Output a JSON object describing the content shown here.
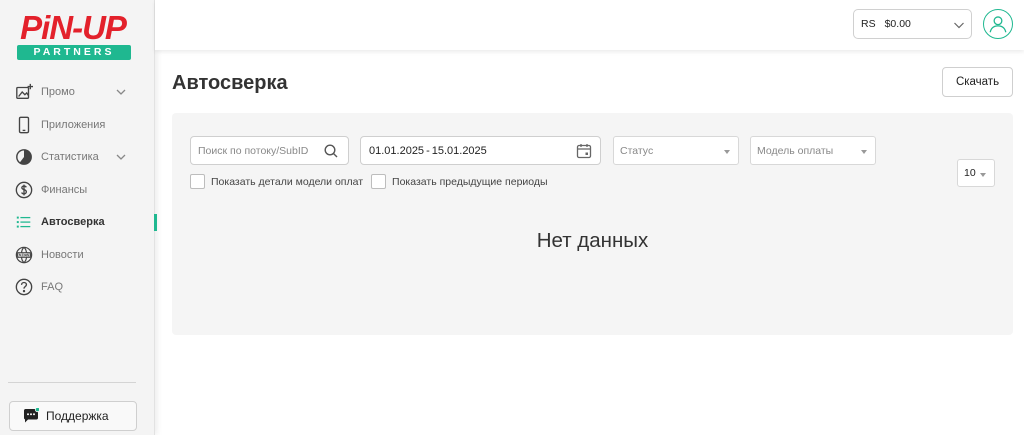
{
  "brand": {
    "logo_main": "PiN-UP",
    "logo_sub": "PARTNERS",
    "accent_color": "#1fb890",
    "logo_red": "#e3212b"
  },
  "sidebar": {
    "items": [
      {
        "label": "Промо",
        "icon": "promo-icon"
      },
      {
        "label": "Приложения",
        "icon": "phone-icon"
      },
      {
        "label": "Статистика",
        "icon": "pie-chart-icon"
      },
      {
        "label": "Финансы",
        "icon": "dollar-icon"
      },
      {
        "label": "Автосверка",
        "icon": "list-icon"
      },
      {
        "label": "Новости",
        "icon": "news-icon"
      },
      {
        "label": "FAQ",
        "icon": "question-icon"
      }
    ],
    "support_label": "Поддержка"
  },
  "topbar": {
    "currency": "RS",
    "balance": "$0.00"
  },
  "main": {
    "title": "Автосверка",
    "download_label": "Скачать",
    "filters": {
      "search_placeholder": "Поиск по потоку/SubID",
      "date_from": "01.01.2025",
      "date_sep": "-",
      "date_to": "15.01.2025",
      "status_placeholder": "Статус",
      "model_placeholder": "Модель оплаты",
      "show_model_details": "Показать детали модели оплат",
      "show_previous_periods": "Показать предыдущие периоды",
      "page_size": "10"
    },
    "empty_text": "Нет данных"
  }
}
